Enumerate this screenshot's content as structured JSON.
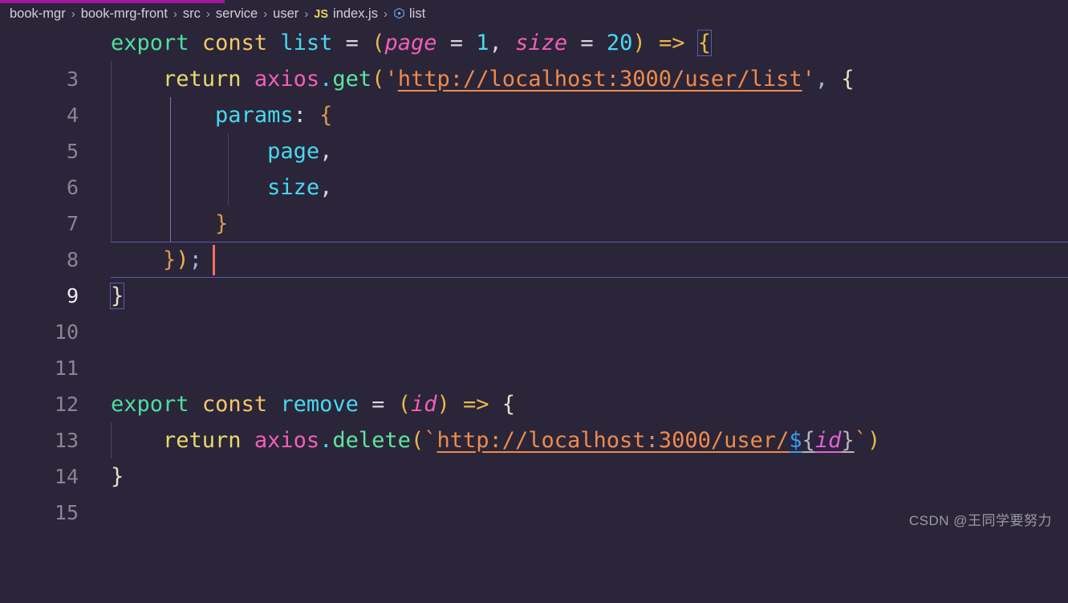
{
  "progress": {
    "percent": 21,
    "color": "#a1179e"
  },
  "breadcrumb": {
    "separator": "›",
    "items": [
      {
        "label": "book-mgr",
        "icon": ""
      },
      {
        "label": "book-mrg-front",
        "icon": ""
      },
      {
        "label": "src",
        "icon": ""
      },
      {
        "label": "service",
        "icon": ""
      },
      {
        "label": "user",
        "icon": ""
      },
      {
        "label": "index.js",
        "icon": "js-file-icon",
        "icon_text": "JS"
      },
      {
        "label": "list",
        "icon": "symbol-method-icon"
      }
    ]
  },
  "editor": {
    "active_line": 9,
    "cursor_line": 9,
    "lines": [
      {
        "num": "3",
        "text": "export const list = (page = 1, size = 20) => {"
      },
      {
        "num": "4",
        "text": "    return axios.get('http://localhost:3000/user/list', {"
      },
      {
        "num": "5",
        "text": "        params: {"
      },
      {
        "num": "6",
        "text": "            page,"
      },
      {
        "num": "7",
        "text": "            size,"
      },
      {
        "num": "8",
        "text": "        }"
      },
      {
        "num": "9",
        "text": "    });"
      },
      {
        "num": "10",
        "text": "}"
      },
      {
        "num": "11",
        "text": ""
      },
      {
        "num": "12",
        "text": ""
      },
      {
        "num": "13",
        "text": "export const remove = (id) => {"
      },
      {
        "num": "14",
        "text": "    return axios.delete(`http://localhost:3000/user/${id}`)"
      },
      {
        "num": "15",
        "text": "}"
      }
    ],
    "urls": {
      "list_url": "http://localhost:3000/user/list",
      "remove_url": "http://localhost:3000/user/${id}"
    },
    "identifiers": {
      "fn_list": "list",
      "fn_remove": "remove",
      "param_page": "page",
      "param_size": "size",
      "param_id": "id",
      "default_page": "1",
      "default_size": "20",
      "object": "axios",
      "method_get": "get",
      "method_delete": "delete",
      "params_key": "params"
    },
    "theme": {
      "background": "#2a2539",
      "line_number": "#898597",
      "active_line_number": "#eceaf2",
      "cursor": "#f2705e",
      "keyword": "#4ce0a0",
      "const": "#f7c768",
      "variable": "#48d9f0",
      "parameter": "#f25fb8",
      "string": "#f08a4b",
      "function": "#5ce6a0",
      "object": "#f25fb8"
    }
  },
  "watermark": {
    "text": "CSDN @王同学要努力"
  }
}
